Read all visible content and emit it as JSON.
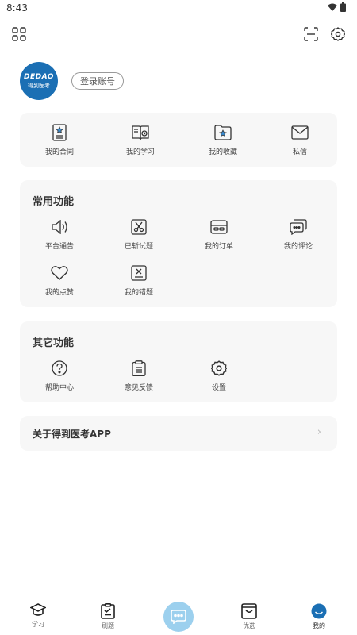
{
  "status_bar": {
    "time": "8:43"
  },
  "profile": {
    "avatar_logo": "DEDAO",
    "avatar_brand": "得到医考",
    "login_label": "登录账号"
  },
  "quick_menu": [
    {
      "label": "我的合同",
      "icon": "contract-icon"
    },
    {
      "label": "我的学习",
      "icon": "study-book-icon"
    },
    {
      "label": "我的收藏",
      "icon": "favorite-folder-icon"
    },
    {
      "label": "私信",
      "icon": "mail-icon"
    }
  ],
  "common": {
    "title": "常用功能",
    "items": [
      {
        "label": "平台通告",
        "icon": "speaker-icon"
      },
      {
        "label": "已斩试题",
        "icon": "scissors-icon"
      },
      {
        "label": "我的订单",
        "icon": "order-card-icon"
      },
      {
        "label": "我的评论",
        "icon": "comment-icon"
      },
      {
        "label": "我的点赞",
        "icon": "heart-icon"
      },
      {
        "label": "我的错题",
        "icon": "wrong-question-icon"
      }
    ]
  },
  "other": {
    "title": "其它功能",
    "items": [
      {
        "label": "帮助中心",
        "icon": "help-icon"
      },
      {
        "label": "意见反馈",
        "icon": "feedback-clipboard-icon"
      },
      {
        "label": "设置",
        "icon": "settings-gear-icon"
      }
    ]
  },
  "about": {
    "label": "关于得到医考APP",
    "chevron": "›"
  },
  "bottom_nav": [
    {
      "label": "学习",
      "icon": "graduation-cap-icon"
    },
    {
      "label": "刷题",
      "icon": "quiz-clipboard-icon"
    },
    {
      "label": "",
      "icon": "chat-bubble-icon"
    },
    {
      "label": "优选",
      "icon": "shopping-bag-icon"
    },
    {
      "label": "我的",
      "icon": "profile-avatar-icon"
    }
  ],
  "colors": {
    "accent": "#1b6fb4",
    "fab": "#9cd0ee",
    "card_bg": "#f7f7f7"
  }
}
